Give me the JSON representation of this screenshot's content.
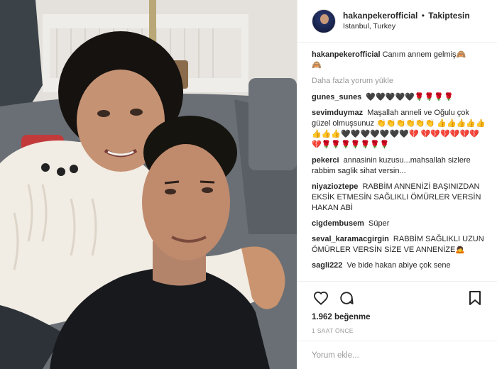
{
  "post": {
    "username": "hakanpekerofficial",
    "separator": "•",
    "follow_status": "Takiptesin",
    "location": "Istanbul, Turkey",
    "caption_user": "hakanpekerofficial",
    "caption_text": "Canım annem gelmiş🙈",
    "caption_text_line2": "🙈",
    "load_more": "Daha fazla yorum yükle",
    "likes": "1.962 beğenme",
    "time_ago": "1 SAAT ÖNCE",
    "add_comment_placeholder": "Yorum ekle..."
  },
  "comments": [
    {
      "user": "gunes_sunes",
      "text": "🖤🖤🖤🖤🖤🌹🌹🌹🌹"
    },
    {
      "user": "sevimduymaz",
      "text": "Maşallah anneli ve Oğulu çok güzel olmuşsunuz 👏👏👏👏👏👏 👍👍👍👍👍👍👍👍🖤🖤🖤🖤🖤🖤🖤💔 💔💔💔💔💔💔💔🌹🌹🌹🌹🌹🌹🌹"
    },
    {
      "user": "pekerci",
      "text": "annasinin kuzusu...mahsallah sizlere rabbim saglik sihat versin..."
    },
    {
      "user": "niyazioztepe",
      "text": "RABBİM ANNENİZİ BAŞINIZDAN EKSİK ETMESİN SAĞLIKLI ÖMÜRLER VERSİN HAKAN ABİ"
    },
    {
      "user": "cigdembusem",
      "text": "Süper"
    },
    {
      "user": "seval_karamacgirgin",
      "text": "RABBİM SAĞLIKLI UZUN ÖMÜRLER VERSİN SİZE VE ANNENİZE🙇"
    },
    {
      "user": "sagli222",
      "text": "Ve bide hakan abiye çok sene"
    }
  ],
  "icons": {
    "like": "heart-icon",
    "comment": "comment-bubble-icon",
    "save": "bookmark-icon"
  },
  "colors": {
    "text": "#262626",
    "muted": "#999999",
    "border": "#efefef"
  }
}
